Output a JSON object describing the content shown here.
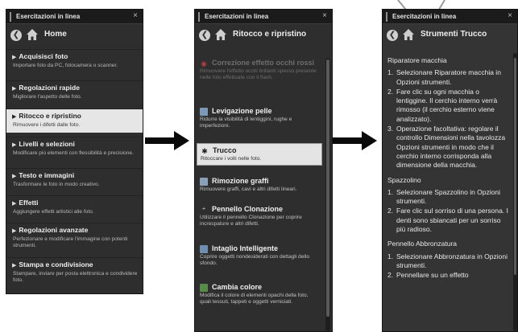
{
  "panel1": {
    "title": "Esercitazioni in linea",
    "close": "×",
    "nav_title": "Home",
    "items": [
      {
        "name": "Acquisisci foto",
        "desc": "Importare foto da PC, fotocamera o scanner."
      },
      {
        "name": "Regolazioni rapide",
        "desc": "Migliorare l'aspetto delle foto."
      },
      {
        "name": "Ritocco e ripristino",
        "desc": "Rimuovere i difetti dalle foto."
      },
      {
        "name": "Livelli e selezioni",
        "desc": "Modificare più elementi con flessibilità e precisione."
      },
      {
        "name": "Testo e immagini",
        "desc": "Trasformare le foto in modo creativo."
      },
      {
        "name": "Effetti",
        "desc": "Aggiungere effetti artistici alle foto."
      },
      {
        "name": "Regolazioni avanzate",
        "desc": "Perfezionare e modificare l'immagine con potenti strumenti."
      },
      {
        "name": "Stampa e condivisione",
        "desc": "Stampare, inviare per posta elettronica e condividere foto."
      }
    ]
  },
  "panel2": {
    "title": "Esercitazioni in linea",
    "close": "×",
    "nav_title": "Ritocco e ripristino",
    "items": [
      {
        "name": "Correzione effetto occhi rossi",
        "desc": "Rimuovere l'effetto occhi brillanti spesso presente nelle foto effettuate con il flash."
      },
      {
        "name": "Levigazione pelle",
        "desc": "Ridurre la visibilità di lentiggini, rughe e imperfezioni."
      },
      {
        "name": "Trucco",
        "desc": "Ritoccare i volti nelle foto."
      },
      {
        "name": "Rimozione graffi",
        "desc": "Rimuovere graffi, cavi e altri difetti lineari."
      },
      {
        "name": "Pennello Clonazione",
        "desc": "Utilizzare il pennello Clonazione per coprire increspature e altri difetti."
      },
      {
        "name": "Intaglio Intelligente",
        "desc": "Coprire oggetti nondesiderati con dettagli dello sfondo."
      },
      {
        "name": "Cambia colore",
        "desc": "Modifica il colore di elementi opachi della foto, quali tessuti, tappeti e oggetti verniciati."
      }
    ]
  },
  "panel3": {
    "title": "Esercitazioni in linea",
    "close": "×",
    "nav_title": "Strumenti Trucco",
    "sections": [
      {
        "title": "Riparatore macchia",
        "steps": [
          "Selezionare Riparatore macchia in Opzioni strumenti.",
          "Fare clic su ogni macchia o lentiggine. Il cerchio interno verrà rimosso (il cerchio esterno viene analizzato).",
          "Operazione facoltativa: regolare il controllo Dimensioni nella tavolozza Opzioni strumenti in modo che il cerchio interno corrisponda alla dimensione della macchia."
        ]
      },
      {
        "title": "Spazzolino",
        "steps": [
          "Selezionare Spazzolino in Opzioni strumenti.",
          "Fare clic sul sorriso di una persona. I denti sono sbiancati per un sorriso più radioso."
        ]
      },
      {
        "title": "Pennello Abbronzatura",
        "steps": [
          "Selezionare Abbronzatura in Opzioni strumenti.",
          "Pennellare su un effetto"
        ]
      }
    ]
  },
  "icons": {
    "back": "back-arrow-icon",
    "home": "home-icon"
  },
  "colors": {
    "panel_bg": "#2e2e2e",
    "titlebar_bg": "#1b1b1b",
    "selected_bg": "#e6e6e6",
    "text": "#e8e8e8"
  }
}
